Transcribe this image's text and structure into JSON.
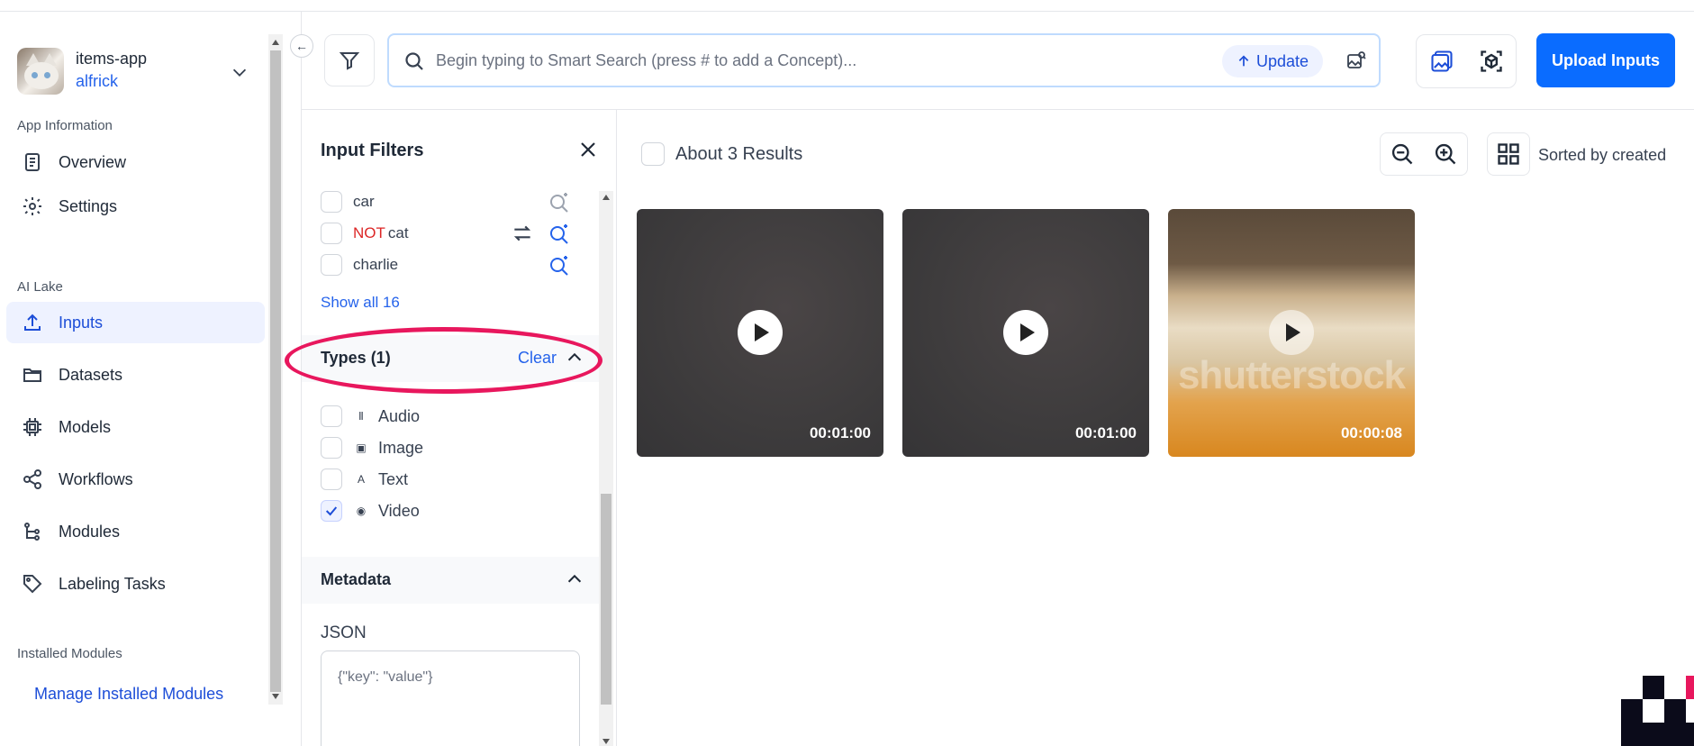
{
  "app": {
    "name": "items-app",
    "user": "alfrick"
  },
  "sidebar": {
    "section_app_info": "App Information",
    "section_ai_lake": "AI Lake",
    "section_installed": "Installed Modules",
    "items": [
      {
        "label": "Overview",
        "icon": "document-icon"
      },
      {
        "label": "Settings",
        "icon": "gear-icon"
      },
      {
        "label": "Inputs",
        "icon": "upload-icon",
        "active": true
      },
      {
        "label": "Datasets",
        "icon": "folder-icon"
      },
      {
        "label": "Models",
        "icon": "chip-icon"
      },
      {
        "label": "Workflows",
        "icon": "share-icon"
      },
      {
        "label": "Modules",
        "icon": "tree-icon"
      },
      {
        "label": "Labeling Tasks",
        "icon": "tag-icon"
      }
    ],
    "manage_link": "Manage Installed Modules",
    "collapse_icon": "←"
  },
  "search": {
    "placeholder": "Begin typing to Smart Search (press # to add a Concept)...",
    "update_label": "Update"
  },
  "toolbar": {
    "upload_label": "Upload Inputs"
  },
  "filters": {
    "title": "Input Filters",
    "concepts": [
      {
        "label": "car",
        "negated": false
      },
      {
        "label": "cat",
        "negated": true,
        "not_label": "NOT"
      },
      {
        "label": "charlie",
        "negated": false
      }
    ],
    "show_all": "Show all 16",
    "types_header": "Types (1)",
    "types_clear": "Clear",
    "types": [
      {
        "label": "Audio",
        "glyph": "Ⅱ",
        "checked": false
      },
      {
        "label": "Image",
        "glyph": "▣",
        "checked": false
      },
      {
        "label": "Text",
        "glyph": "A",
        "checked": false
      },
      {
        "label": "Video",
        "glyph": "◉",
        "checked": true
      }
    ],
    "metadata_header": "Metadata",
    "json_label": "JSON",
    "json_placeholder": "{\"key\": \"value\"}"
  },
  "results": {
    "count_label": "About 3 Results",
    "sort_label": "Sorted by created",
    "items": [
      {
        "duration": "00:01:00",
        "style": "dark"
      },
      {
        "duration": "00:01:00",
        "style": "dark"
      },
      {
        "duration": "00:00:08",
        "style": "beer",
        "watermark": "shutterstock"
      }
    ]
  },
  "colors": {
    "accent": "#0a6cff",
    "highlight_ring": "#e8175d",
    "link": "#2563eb"
  }
}
